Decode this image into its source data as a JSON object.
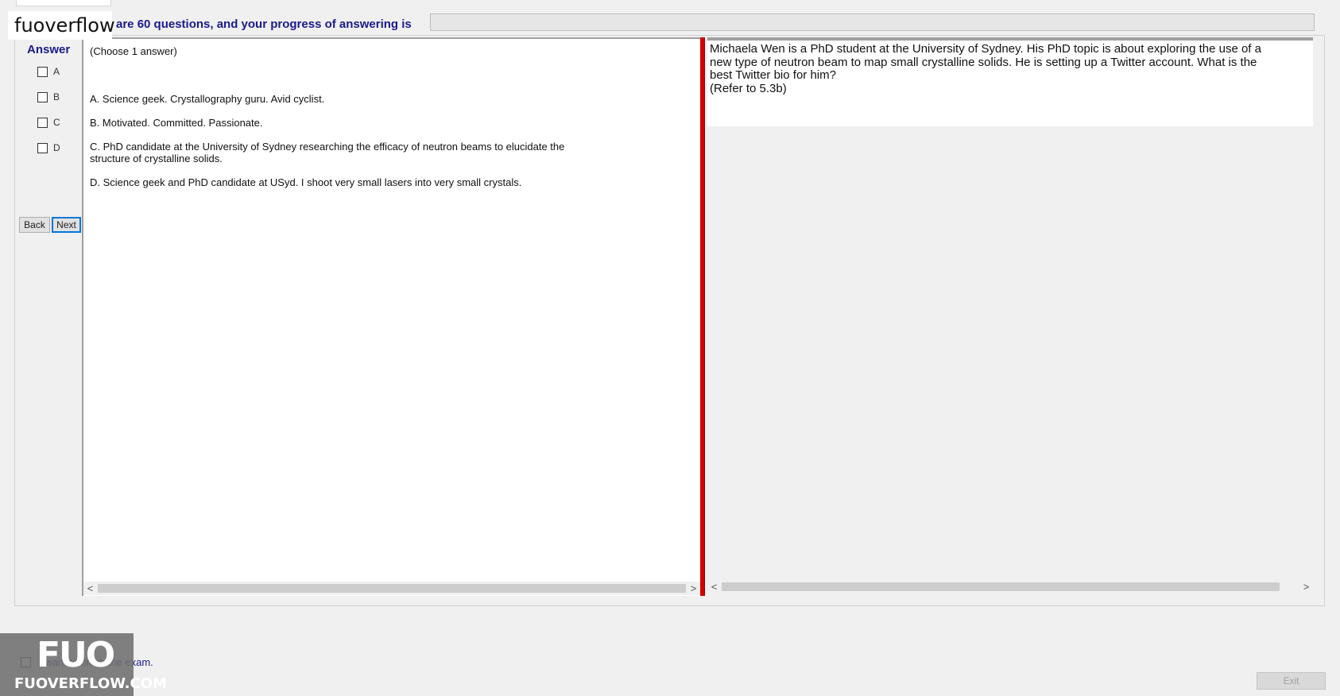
{
  "watermark": {
    "top_text": "fuoverflow",
    "logo_big": "FUO",
    "logo_small": "FUOVERFLOW.COM"
  },
  "header": {
    "progress_text": "are 60 questions, and your progress of answering is",
    "progress_value": 0
  },
  "answer_panel": {
    "title": "Answer",
    "options": [
      "A",
      "B",
      "C",
      "D"
    ]
  },
  "buttons": {
    "back": "Back",
    "next": "Next",
    "exit": "Exit"
  },
  "question": {
    "instruction": "(Choose 1 answer)",
    "answers": [
      "A.  Science geek. Crystallography guru. Avid cyclist.",
      "B.  Motivated. Committed. Passionate.",
      "C.  PhD candidate at the University of Sydney researching the efficacy of neutron beams to elucidate the structure of crystalline solids.",
      "D.  Science geek and PhD candidate at USyd. I shoot very small lasers into very small crystals."
    ]
  },
  "stem": {
    "text": "Michaela Wen is a PhD student at the University of Sydney. His PhD topic is about exploring the use of a new type of neutron beam to map small crystalline solids. He is setting up a Twitter account. What is the best Twitter bio for him?",
    "ref": "(Refer to 5.3b)"
  },
  "footer": {
    "finish_label": "I want to finish the exam."
  },
  "scroll": {
    "left": "<",
    "right": ">"
  },
  "colors": {
    "accent": "#1a1a8c",
    "divider": "#d40000",
    "progress": "#06b025"
  }
}
